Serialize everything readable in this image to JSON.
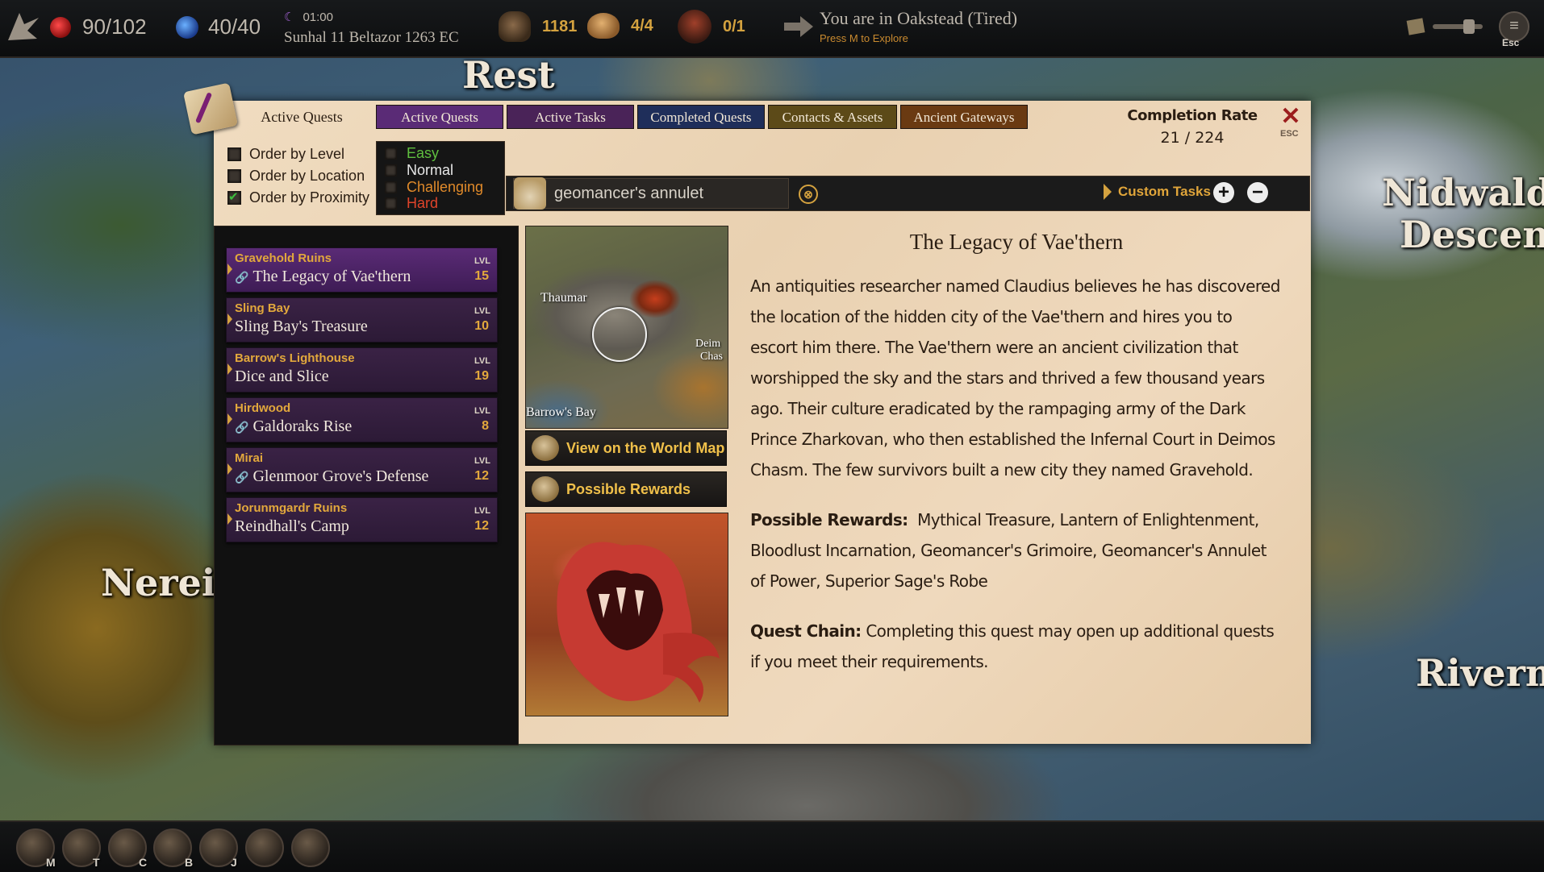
{
  "hud": {
    "health": "90/102",
    "mana": "40/40",
    "time": "01:00",
    "date": "Sunhal 11 Beltazor 1263 EC",
    "gold": "1181",
    "food": "4/4",
    "companions": "0/1",
    "location": "You are in Oakstead (Tired)",
    "explore_hint": "Press M to Explore",
    "menu_key": "Esc"
  },
  "map_labels": {
    "rest": "Rest",
    "nidwald": "Nidwald's",
    "descent": "Descent",
    "nereis": "Nereis",
    "riverm": "Riverm"
  },
  "panel": {
    "title": "Active Quests",
    "tabs": [
      "Active Quests",
      "Active Tasks",
      "Completed Quests",
      "Contacts & Assets",
      "Ancient Gateways"
    ],
    "completion_label": "Completion Rate",
    "completion_value": "21 / 224",
    "close_label": "ESC",
    "order_options": [
      {
        "label": "Order by Level",
        "checked": false
      },
      {
        "label": "Order by Location",
        "checked": false
      },
      {
        "label": "Order by Proximity",
        "checked": true
      }
    ],
    "difficulties": [
      {
        "label": "Easy",
        "color": "#5fbf3f"
      },
      {
        "label": "Normal",
        "color": "#e8e8e8"
      },
      {
        "label": "Challenging",
        "color": "#e08a2a"
      },
      {
        "label": "Hard",
        "color": "#e0442a"
      }
    ],
    "search_value": "geomancer's annulet",
    "clear_icon": "⊗",
    "custom_tasks": "Custom Tasks",
    "add_icon": "+",
    "remove_icon": "−",
    "colors": {
      "active_tab": "#5a2b76",
      "tab_purple": "#4a2358",
      "tab_blue": "#1f2e5a",
      "tab_olive": "#5c4a18",
      "tab_brown": "#6a3a12",
      "accent_gold": "#e2a83c"
    }
  },
  "quests": [
    {
      "location": "Gravehold Ruins",
      "name": "The Legacy of Vae'thern",
      "level": "15",
      "chain": true,
      "active": true
    },
    {
      "location": "Sling Bay",
      "name": "Sling Bay's Treasure",
      "level": "10",
      "chain": false,
      "active": false
    },
    {
      "location": "Barrow's Lighthouse",
      "name": "Dice and Slice",
      "level": "19",
      "chain": false,
      "active": false
    },
    {
      "location": "Hirdwood",
      "name": "Galdoraks Rise",
      "level": "8",
      "chain": true,
      "active": false
    },
    {
      "location": "Mirai",
      "name": "Glenmoor Grove's Defense",
      "level": "12",
      "chain": true,
      "active": false
    },
    {
      "location": "Jorunmgardr Ruins",
      "name": "Reindhall's Camp",
      "level": "12",
      "chain": false,
      "active": false
    }
  ],
  "level_label": "LVL",
  "minimap": {
    "labels": [
      "Thaumar",
      "Deim",
      "Chas",
      "Barrow's Bay"
    ]
  },
  "side_buttons": {
    "world_map": "View on the World Map",
    "rewards": "Possible Rewards"
  },
  "detail": {
    "title": "The Legacy of Vae'thern",
    "description": "An antiquities researcher named Claudius believes he has discovered the location of the hidden city of the Vae'thern and hires you to escort him there. The Vae'thern were an ancient civilization that worshipped the sky and the stars and thrived a few thousand years ago. Their culture eradicated by the rampaging army of the Dark Prince Zharkovan, who then established the Infernal Court in Deimos Chasm. The few survivors built a new city they named Gravehold.",
    "rewards_label": "Possible Rewards:",
    "rewards_text": "Mythical Treasure, Lantern of Enlightenment, Bloodlust Incarnation, Geomancer's Grimoire, Geomancer's Annulet of Power, Superior Sage's Robe",
    "chain_label": "Quest Chain:",
    "chain_text": "Completing this quest may open up additional quests if you meet their requirements."
  },
  "bottom_keys": [
    "M",
    "T",
    "C",
    "B",
    "J"
  ]
}
